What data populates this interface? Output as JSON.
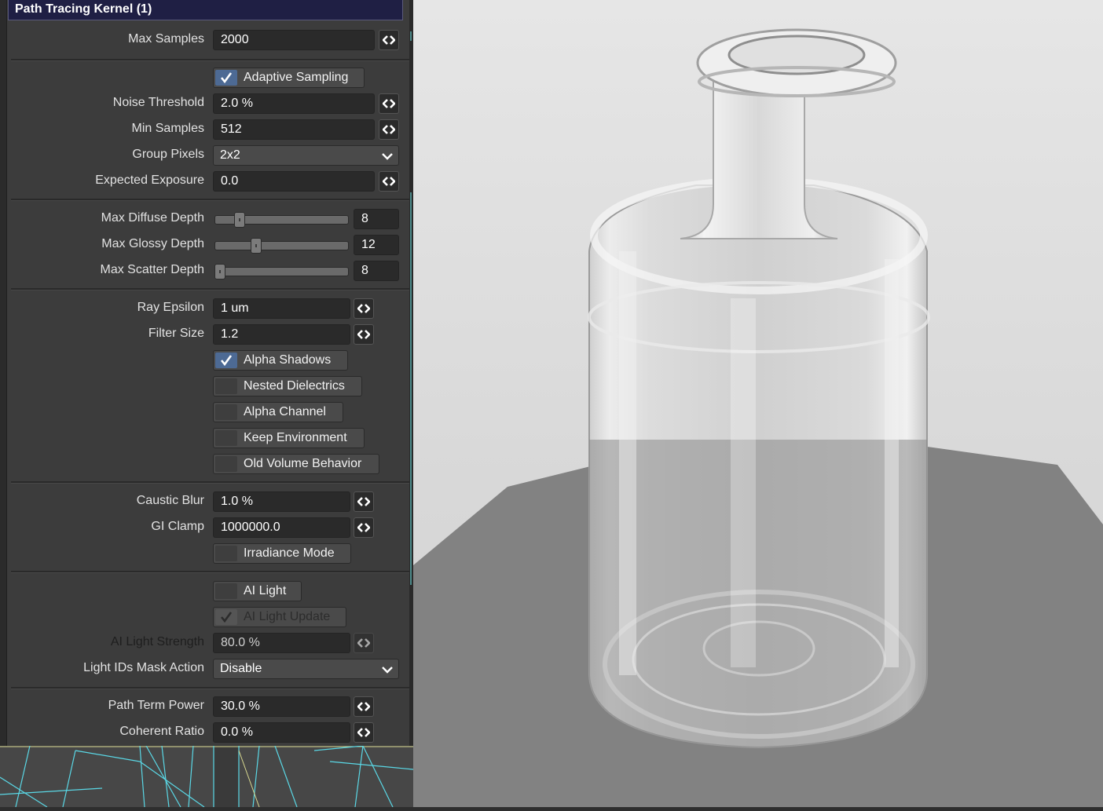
{
  "panel": {
    "title": "Path Tracing Kernel (1)",
    "max_samples": {
      "label": "Max Samples",
      "value": "2000"
    },
    "adaptive_sampling": {
      "label": "Adaptive Sampling",
      "checked": true
    },
    "noise_threshold": {
      "label": "Noise Threshold",
      "value": "2.0 %"
    },
    "min_samples": {
      "label": "Min Samples",
      "value": "512"
    },
    "group_pixels": {
      "label": "Group Pixels",
      "value": "2x2"
    },
    "expected_exposure": {
      "label": "Expected Exposure",
      "value": "0.0"
    },
    "max_diffuse_depth": {
      "label": "Max Diffuse Depth",
      "value": "8",
      "level": 0.16
    },
    "max_glossy_depth": {
      "label": "Max Glossy Depth",
      "value": "12",
      "level": 0.29
    },
    "max_scatter_depth": {
      "label": "Max Scatter Depth",
      "value": "8",
      "level": 0.0
    },
    "ray_epsilon": {
      "label": "Ray Epsilon",
      "value": "1 um"
    },
    "filter_size": {
      "label": "Filter Size",
      "value": "1.2"
    },
    "alpha_shadows": {
      "label": "Alpha Shadows",
      "checked": true
    },
    "nested_dielectrics": {
      "label": "Nested Dielectrics",
      "checked": false
    },
    "alpha_channel": {
      "label": "Alpha Channel",
      "checked": false
    },
    "keep_environment": {
      "label": "Keep Environment",
      "checked": false
    },
    "old_volume_behavior": {
      "label": "Old Volume Behavior",
      "checked": false
    },
    "caustic_blur": {
      "label": "Caustic Blur",
      "value": "1.0 %"
    },
    "gi_clamp": {
      "label": "GI Clamp",
      "value": "1000000.0"
    },
    "irradiance_mode": {
      "label": "Irradiance Mode",
      "checked": false
    },
    "ai_light": {
      "label": "AI Light",
      "checked": false
    },
    "ai_light_update": {
      "label": "AI Light Update",
      "checked": true,
      "disabled": true
    },
    "ai_light_strength": {
      "label": "AI Light Strength",
      "value": "80.0 %",
      "disabled": true
    },
    "light_ids_mask_action": {
      "label": "Light IDs Mask Action",
      "value": "Disable"
    },
    "path_term_power": {
      "label": "Path Term Power",
      "value": "30.0 %"
    },
    "coherent_ratio": {
      "label": "Coherent Ratio",
      "value": "0.0 %"
    }
  },
  "colors": {
    "panel_bg": "#3c3c3c",
    "title_bg": "#1f1f44",
    "check_accent": "#4d6a94",
    "wireframe": "#5ad8e6"
  },
  "icons": [
    "spin-arrows-icon",
    "check-icon",
    "chevron-down-icon"
  ]
}
